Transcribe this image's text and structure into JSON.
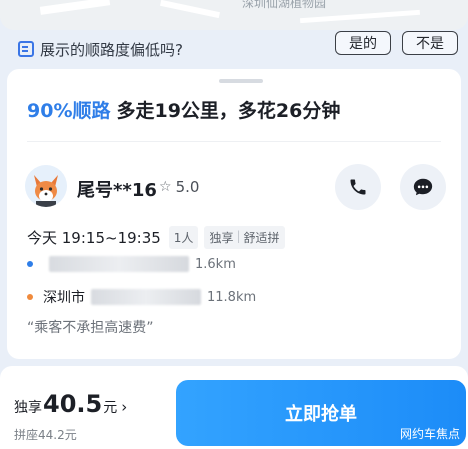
{
  "map": {
    "label": "深圳仙湖植物园"
  },
  "feedback": {
    "question": "展示的顺路度偏低吗?",
    "yes_label": "是的",
    "no_label": "不是"
  },
  "summary": {
    "rate": "90%顺路",
    "detail": "多走19公里，多花26分钟"
  },
  "passenger": {
    "name": "尾号**16",
    "rating": "5.0",
    "time": "今天 19:15~19:35",
    "seats": "1人",
    "tag_type": "独享",
    "tag_comfort": "舒适拼",
    "pickup_distance": "1.6km",
    "dropoff_city": "深圳市",
    "dropoff_distance": "11.8km",
    "remark": "“乘客不承担高速费”"
  },
  "pricing": {
    "main_label": "独享",
    "main_amount": "40.5",
    "main_unit": "元",
    "sub": "拼座44.2元"
  },
  "actions": {
    "grab_label": "立即抢单"
  },
  "watermark": "网约车焦点",
  "colors": {
    "accent": "#2f7ee8",
    "button": "#1c8cf8",
    "pickup_dot": "#2f7ee8",
    "dropoff_dot": "#f08a3c"
  },
  "icons": [
    "feedback-icon",
    "fox-avatar",
    "star-icon",
    "phone-icon",
    "chat-icon",
    "chevron-right-icon"
  ]
}
